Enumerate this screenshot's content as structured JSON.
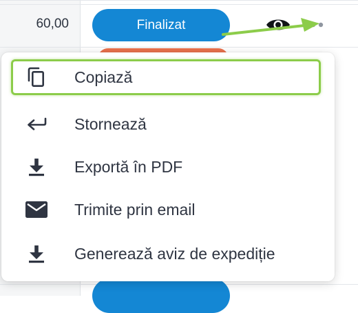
{
  "row": {
    "amount": "60,00",
    "status_label": "Finalizat"
  },
  "row_actions": {
    "view_icon": "eye-icon",
    "more_icon": "more-horizontal-icon"
  },
  "menu": {
    "items": [
      {
        "label": "Copiază",
        "icon": "copy-icon"
      },
      {
        "label": "Stornează",
        "icon": "return-arrow-icon"
      },
      {
        "label": "Exportă în PDF",
        "icon": "download-icon"
      },
      {
        "label": "Trimite prin email",
        "icon": "mail-icon"
      },
      {
        "label": "Generează aviz de expediție",
        "icon": "download-icon"
      }
    ]
  },
  "colors": {
    "status_finalized": "#1487d4",
    "status_orange": "#e9714d",
    "annotation_highlight": "#8ccc4a",
    "text": "#2f3542",
    "icon": "#2f3542"
  }
}
